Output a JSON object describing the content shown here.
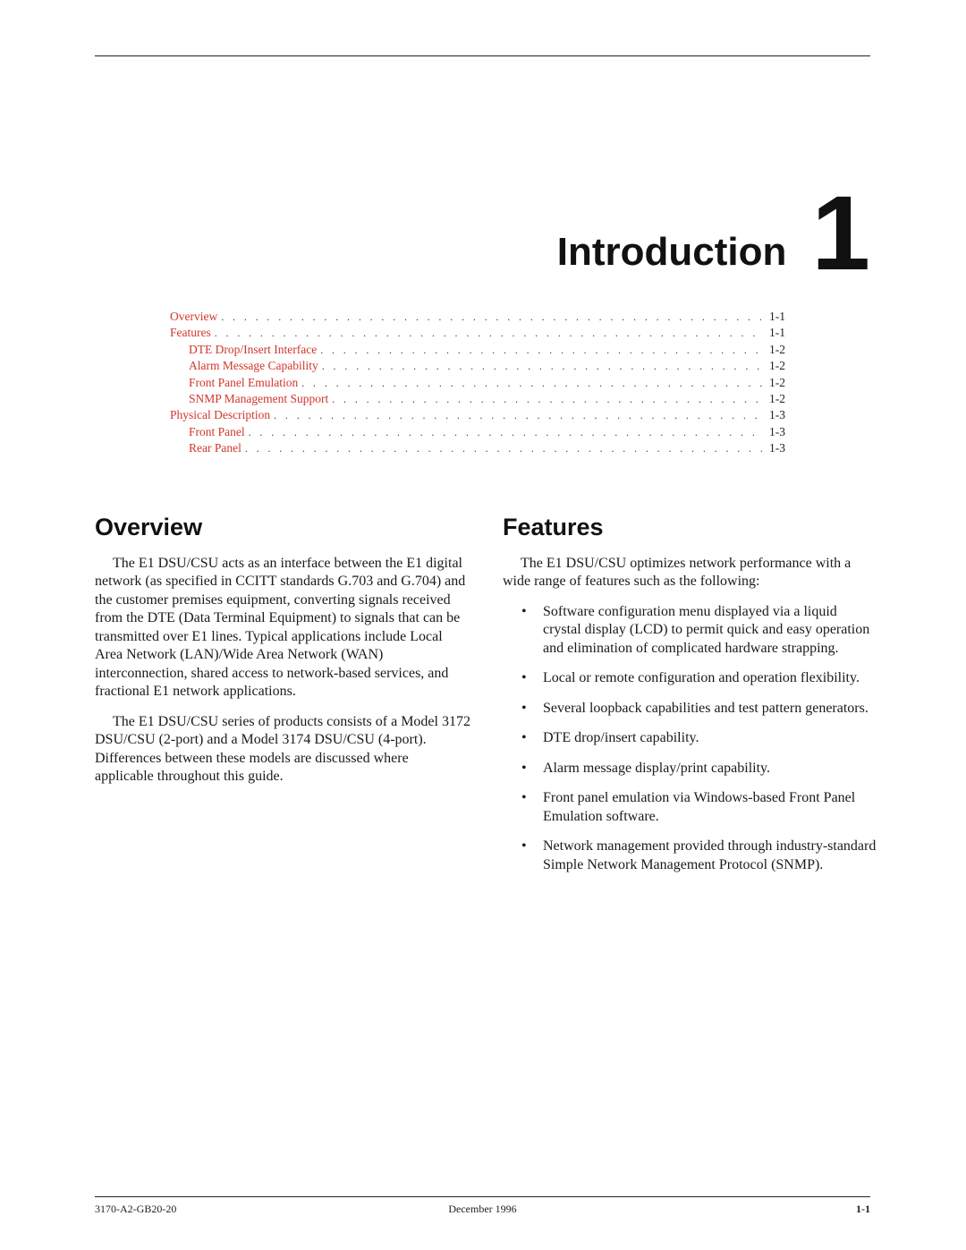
{
  "chapter": {
    "title": "Introduction",
    "number": "1"
  },
  "toc": [
    {
      "label": "Overview",
      "page": "1-1",
      "level": 1
    },
    {
      "label": "Features",
      "page": "1-1",
      "level": 1
    },
    {
      "label": "DTE Drop/Insert Interface",
      "page": "1-2",
      "level": 2
    },
    {
      "label": "Alarm Message Capability",
      "page": "1-2",
      "level": 2
    },
    {
      "label": "Front Panel Emulation",
      "page": "1-2",
      "level": 2
    },
    {
      "label": "SNMP Management Support",
      "page": "1-2",
      "level": 2
    },
    {
      "label": "Physical Description",
      "page": "1-3",
      "level": 1
    },
    {
      "label": "Front Panel",
      "page": "1-3",
      "level": 2
    },
    {
      "label": "Rear Panel",
      "page": "1-3",
      "level": 2
    }
  ],
  "overview": {
    "heading": "Overview",
    "paragraphs": [
      "The E1 DSU/CSU acts as an interface between the E1 digital network (as specified in CCITT standards G.703 and G.704) and the customer premises equipment, converting signals received from the DTE (Data Terminal Equipment) to signals that can be transmitted over E1 lines. Typical applications include Local Area Network (LAN)/Wide Area Network (WAN) interconnection, shared access to network-based services, and fractional E1 network applications.",
      "The E1 DSU/CSU series of products consists of a Model 3172 DSU/CSU (2-port) and a Model 3174 DSU/CSU (4-port). Differences between these models are discussed where applicable throughout this guide."
    ]
  },
  "features": {
    "heading": "Features",
    "intro": "The E1 DSU/CSU optimizes network performance with a wide range of features such as the following:",
    "bullet": "•",
    "items": [
      "Software configuration menu displayed via a liquid crystal display (LCD) to permit quick and easy operation and elimination of complicated hardware strapping.",
      "Local or remote configuration and operation flexibility.",
      "Several loopback capabilities and test pattern generators.",
      "DTE drop/insert capability.",
      "Alarm message display/print capability.",
      "Front panel emulation via Windows-based Front Panel Emulation software.",
      "Network management provided through industry-standard Simple Network Management Protocol (SNMP)."
    ]
  },
  "footer": {
    "doc_number": "3170-A2-GB20-20",
    "date": "December 1996",
    "page": "1-1"
  },
  "colors": {
    "toc_link": "#d0362c",
    "text": "#1a1a1a"
  }
}
